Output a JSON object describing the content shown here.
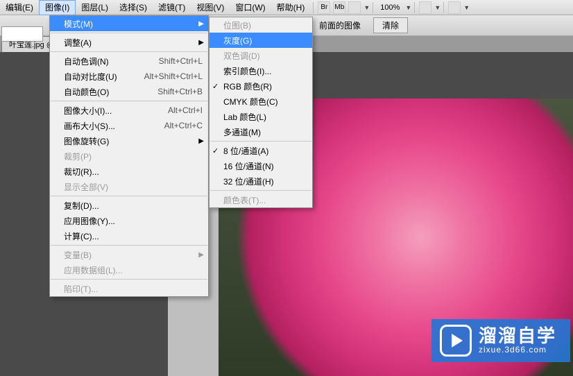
{
  "menubar": {
    "items": [
      "编辑(E)",
      "图像(I)",
      "图层(L)",
      "选择(S)",
      "滤镜(T)",
      "视图(V)",
      "窗口(W)",
      "帮助(H)"
    ],
    "active_index": 1,
    "tool_labels": [
      "Br",
      "Mb"
    ],
    "zoom": "100%"
  },
  "optbar": {
    "label": "前面的图像",
    "clear": "清除"
  },
  "tab": {
    "title": "叶宝莲.jpg @"
  },
  "menu1": [
    {
      "type": "item",
      "label": "模式(M)",
      "arrow": true,
      "hover": true
    },
    {
      "type": "sep"
    },
    {
      "type": "item",
      "label": "调整(A)",
      "arrow": true
    },
    {
      "type": "sep"
    },
    {
      "type": "item",
      "label": "自动色调(N)",
      "shortcut": "Shift+Ctrl+L"
    },
    {
      "type": "item",
      "label": "自动对比度(U)",
      "shortcut": "Alt+Shift+Ctrl+L"
    },
    {
      "type": "item",
      "label": "自动颜色(O)",
      "shortcut": "Shift+Ctrl+B"
    },
    {
      "type": "sep"
    },
    {
      "type": "item",
      "label": "图像大小(I)...",
      "shortcut": "Alt+Ctrl+I"
    },
    {
      "type": "item",
      "label": "画布大小(S)...",
      "shortcut": "Alt+Ctrl+C"
    },
    {
      "type": "item",
      "label": "图像旋转(G)",
      "arrow": true
    },
    {
      "type": "item",
      "label": "裁剪(P)",
      "disabled": true
    },
    {
      "type": "item",
      "label": "裁切(R)..."
    },
    {
      "type": "item",
      "label": "显示全部(V)",
      "disabled": true
    },
    {
      "type": "sep"
    },
    {
      "type": "item",
      "label": "复制(D)..."
    },
    {
      "type": "item",
      "label": "应用图像(Y)..."
    },
    {
      "type": "item",
      "label": "计算(C)..."
    },
    {
      "type": "sep"
    },
    {
      "type": "item",
      "label": "变量(B)",
      "arrow": true,
      "disabled": true
    },
    {
      "type": "item",
      "label": "应用数据组(L)...",
      "disabled": true
    },
    {
      "type": "sep"
    },
    {
      "type": "item",
      "label": "陷印(T)...",
      "disabled": true
    }
  ],
  "menu2": [
    {
      "type": "item",
      "label": "位图(B)",
      "disabled": true
    },
    {
      "type": "item",
      "label": "灰度(G)",
      "hover": true
    },
    {
      "type": "item",
      "label": "双色调(D)",
      "disabled": true
    },
    {
      "type": "item",
      "label": "索引颜色(I)..."
    },
    {
      "type": "item",
      "label": "RGB 颜色(R)",
      "check": true
    },
    {
      "type": "item",
      "label": "CMYK 颜色(C)"
    },
    {
      "type": "item",
      "label": "Lab 颜色(L)"
    },
    {
      "type": "item",
      "label": "多通道(M)"
    },
    {
      "type": "sep"
    },
    {
      "type": "item",
      "label": "8 位/通道(A)",
      "check": true
    },
    {
      "type": "item",
      "label": "16 位/通道(N)"
    },
    {
      "type": "item",
      "label": "32 位/通道(H)"
    },
    {
      "type": "sep"
    },
    {
      "type": "item",
      "label": "颜色表(T)...",
      "disabled": true
    }
  ],
  "watermark": {
    "title": "溜溜自学",
    "sub": "zixue.3d66.com"
  }
}
